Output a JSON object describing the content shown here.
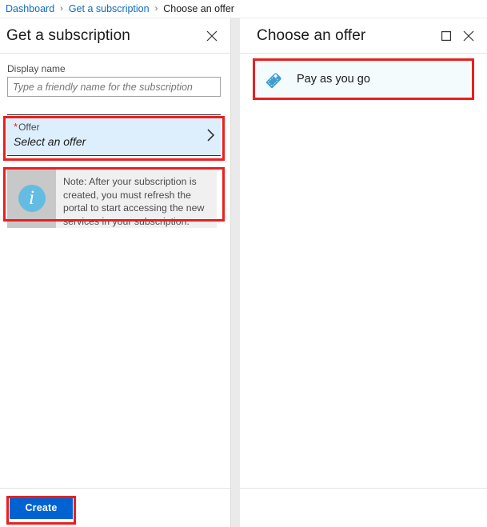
{
  "breadcrumb": {
    "items": [
      {
        "label": "Dashboard",
        "type": "link"
      },
      {
        "label": "Get a subscription",
        "type": "link"
      },
      {
        "label": "Choose an offer",
        "type": "current"
      }
    ],
    "separator": "›"
  },
  "left_blade": {
    "title": "Get a subscription",
    "close_icon": "close-icon",
    "display_name": {
      "label": "Display name",
      "value": "",
      "placeholder": "Type a friendly name for the subscription"
    },
    "offer_picker": {
      "required_marker": "*",
      "label": "Offer",
      "value": "Select an offer",
      "chevron_icon": "chevron-right-icon"
    },
    "note": {
      "icon": "info-icon",
      "icon_glyph": "i",
      "text": "Note: After your subscription is created, you must refresh the portal to start accessing the new services in your subscription."
    },
    "footer": {
      "create_label": "Create"
    }
  },
  "right_blade": {
    "title": "Choose an offer",
    "maximize_icon": "maximize-icon",
    "close_icon": "close-icon",
    "offers": [
      {
        "name": "Pay as you go",
        "icon": "price-tag-icon"
      }
    ]
  },
  "colors": {
    "link": "#0f6cbd",
    "primary_button": "#0063d1",
    "annotation": "#e8201f",
    "picker_background": "#ddeefc",
    "offer_row_background": "#f3fbfd",
    "info_icon": "#64bce3",
    "note_icon_cell": "#c8c8c8",
    "note_background": "#f0f0f0"
  }
}
